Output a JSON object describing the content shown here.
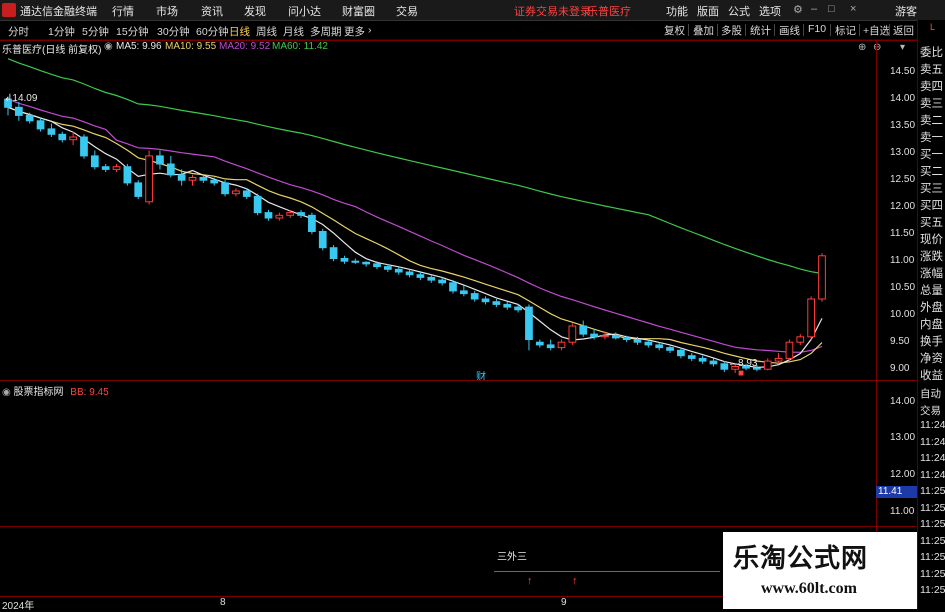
{
  "app": {
    "title": "通达信金融终端",
    "menu": [
      "行情",
      "市场",
      "资讯",
      "发现",
      "问小达",
      "财富圈",
      "交易"
    ],
    "notice": "证券交易未登录",
    "stock_name": "乐普医疗",
    "menu_right": [
      "功能",
      "版面",
      "公式",
      "选项"
    ],
    "guest": "游客"
  },
  "periods": {
    "items": [
      "分时",
      "1分钟",
      "5分钟",
      "15分钟",
      "30分钟",
      "60分钟",
      "日线",
      "周线",
      "月线",
      "多周期",
      "更多"
    ],
    "active": "日线",
    "more_arrow": "›",
    "right_buttons": [
      "复权",
      "叠加",
      "多股",
      "统计",
      "画线",
      "F10",
      "标记",
      "+自选",
      "返回"
    ]
  },
  "chart_header": {
    "title": "乐普医疗(日线 前复权)",
    "ma": [
      {
        "label": "MA5: 9.96",
        "color": "#e8e8e8"
      },
      {
        "label": "MA10: 9.55",
        "color": "#e8d26a"
      },
      {
        "label": "MA20: 9.52",
        "color": "#c04bd0"
      },
      {
        "label": "MA60: 11.42",
        "color": "#3ec94a"
      }
    ]
  },
  "indicator_header": {
    "title": "股票指标网",
    "value": "BB: 9.45",
    "value_color": "#ff4444"
  },
  "main_axis_ticks": [
    "14.50",
    "14.00",
    "13.50",
    "13.00",
    "12.50",
    "12.00",
    "11.50",
    "11.00",
    "10.50",
    "10.00",
    "9.50",
    "9.00"
  ],
  "sub_axis_ticks": [
    "14.00",
    "13.00",
    "12.00",
    "11.00"
  ],
  "sub_axis_current": "11.41",
  "annotations": {
    "high": "14.09",
    "low": "8.93",
    "cai": "财",
    "signal_label": "三外三"
  },
  "date_labels": [
    "2024年",
    "8",
    "9"
  ],
  "right_panel": [
    "委比",
    "卖五",
    "卖四",
    "卖三",
    "卖二",
    "卖一",
    "买一",
    "买二",
    "买三",
    "买四",
    "买五",
    "现价",
    "涨跌",
    "涨幅",
    "总量",
    "外盘",
    "内盘",
    "换手",
    "净资",
    "收益"
  ],
  "right_panel_lower": [
    "自动",
    "交易",
    "11:24",
    "11:24",
    "11:24",
    "11:24",
    "11:25",
    "11:25",
    "11:25",
    "11:25",
    "11:25",
    "11:25",
    "11:25"
  ],
  "watermark": {
    "title": "乐淘公式网",
    "url": "www.60lt.com"
  },
  "colors": {
    "up": "#ff3b3b",
    "down": "#38c8f0",
    "ma5": "#e8e8e8",
    "ma10": "#e8d26a",
    "ma20": "#c04bd0",
    "ma60": "#3ec94a",
    "grid": "#7a0000"
  },
  "chart_data": {
    "type": "candlestick",
    "ylim": [
      8.8,
      14.8
    ],
    "candles": [
      [
        14.0,
        14.05,
        13.7,
        13.85
      ],
      [
        13.85,
        13.95,
        13.6,
        13.7
      ],
      [
        13.7,
        13.75,
        13.55,
        13.6
      ],
      [
        13.6,
        13.65,
        13.4,
        13.45
      ],
      [
        13.45,
        13.55,
        13.3,
        13.35
      ],
      [
        13.35,
        13.4,
        13.2,
        13.25
      ],
      [
        13.25,
        13.4,
        13.15,
        13.3
      ],
      [
        13.3,
        13.35,
        12.9,
        12.95
      ],
      [
        12.95,
        13.05,
        12.7,
        12.75
      ],
      [
        12.75,
        12.8,
        12.65,
        12.7
      ],
      [
        12.7,
        12.8,
        12.65,
        12.75
      ],
      [
        12.75,
        12.8,
        12.4,
        12.45
      ],
      [
        12.45,
        12.5,
        12.15,
        12.2
      ],
      [
        12.1,
        13.05,
        12.05,
        12.95
      ],
      [
        12.95,
        13.05,
        12.7,
        12.8
      ],
      [
        12.8,
        12.95,
        12.55,
        12.6
      ],
      [
        12.6,
        12.7,
        12.4,
        12.5
      ],
      [
        12.5,
        12.6,
        12.4,
        12.55
      ],
      [
        12.55,
        12.6,
        12.45,
        12.5
      ],
      [
        12.5,
        12.55,
        12.4,
        12.45
      ],
      [
        12.45,
        12.5,
        12.2,
        12.25
      ],
      [
        12.25,
        12.35,
        12.2,
        12.3
      ],
      [
        12.3,
        12.35,
        12.15,
        12.2
      ],
      [
        12.2,
        12.25,
        11.85,
        11.9
      ],
      [
        11.9,
        11.95,
        11.75,
        11.8
      ],
      [
        11.8,
        11.9,
        11.75,
        11.85
      ],
      [
        11.85,
        11.95,
        11.8,
        11.9
      ],
      [
        11.9,
        11.95,
        11.8,
        11.85
      ],
      [
        11.85,
        11.9,
        11.5,
        11.55
      ],
      [
        11.55,
        11.6,
        11.2,
        11.25
      ],
      [
        11.25,
        11.3,
        11.0,
        11.05
      ],
      [
        11.05,
        11.1,
        10.95,
        11.0
      ],
      [
        11.0,
        11.05,
        10.95,
        10.98
      ],
      [
        10.98,
        11.0,
        10.9,
        10.95
      ],
      [
        10.95,
        11.0,
        10.85,
        10.9
      ],
      [
        10.9,
        10.95,
        10.8,
        10.85
      ],
      [
        10.85,
        10.9,
        10.75,
        10.8
      ],
      [
        10.8,
        10.85,
        10.7,
        10.75
      ],
      [
        10.75,
        10.8,
        10.65,
        10.7
      ],
      [
        10.7,
        10.75,
        10.6,
        10.65
      ],
      [
        10.65,
        10.7,
        10.55,
        10.6
      ],
      [
        10.6,
        10.65,
        10.4,
        10.45
      ],
      [
        10.45,
        10.55,
        10.35,
        10.4
      ],
      [
        10.4,
        10.45,
        10.25,
        10.3
      ],
      [
        10.3,
        10.35,
        10.2,
        10.25
      ],
      [
        10.25,
        10.3,
        10.15,
        10.2
      ],
      [
        10.2,
        10.25,
        10.1,
        10.15
      ],
      [
        10.15,
        10.2,
        10.05,
        10.1
      ],
      [
        10.15,
        10.2,
        9.35,
        9.55
      ],
      [
        9.5,
        9.55,
        9.4,
        9.45
      ],
      [
        9.45,
        9.55,
        9.35,
        9.4
      ],
      [
        9.4,
        9.55,
        9.35,
        9.5
      ],
      [
        9.5,
        9.85,
        9.45,
        9.8
      ],
      [
        9.8,
        9.9,
        9.6,
        9.65
      ],
      [
        9.65,
        9.75,
        9.55,
        9.6
      ],
      [
        9.6,
        9.7,
        9.55,
        9.62
      ],
      [
        9.62,
        9.68,
        9.55,
        9.58
      ],
      [
        9.58,
        9.62,
        9.5,
        9.55
      ],
      [
        9.55,
        9.6,
        9.45,
        9.5
      ],
      [
        9.5,
        9.55,
        9.4,
        9.45
      ],
      [
        9.45,
        9.5,
        9.35,
        9.4
      ],
      [
        9.4,
        9.45,
        9.3,
        9.35
      ],
      [
        9.35,
        9.4,
        9.2,
        9.25
      ],
      [
        9.25,
        9.3,
        9.15,
        9.2
      ],
      [
        9.2,
        9.25,
        9.1,
        9.15
      ],
      [
        9.15,
        9.2,
        9.05,
        9.1
      ],
      [
        9.1,
        9.15,
        8.95,
        9.0
      ],
      [
        9.0,
        9.1,
        8.93,
        9.05
      ],
      [
        9.05,
        9.1,
        8.98,
        9.02
      ],
      [
        9.02,
        9.08,
        8.96,
        9.0
      ],
      [
        9.0,
        9.2,
        8.98,
        9.15
      ],
      [
        9.15,
        9.3,
        9.1,
        9.2
      ],
      [
        9.2,
        9.55,
        9.15,
        9.5
      ],
      [
        9.5,
        9.65,
        9.45,
        9.6
      ],
      [
        9.6,
        10.35,
        9.55,
        10.3
      ],
      [
        10.3,
        11.15,
        10.25,
        11.1
      ]
    ]
  }
}
